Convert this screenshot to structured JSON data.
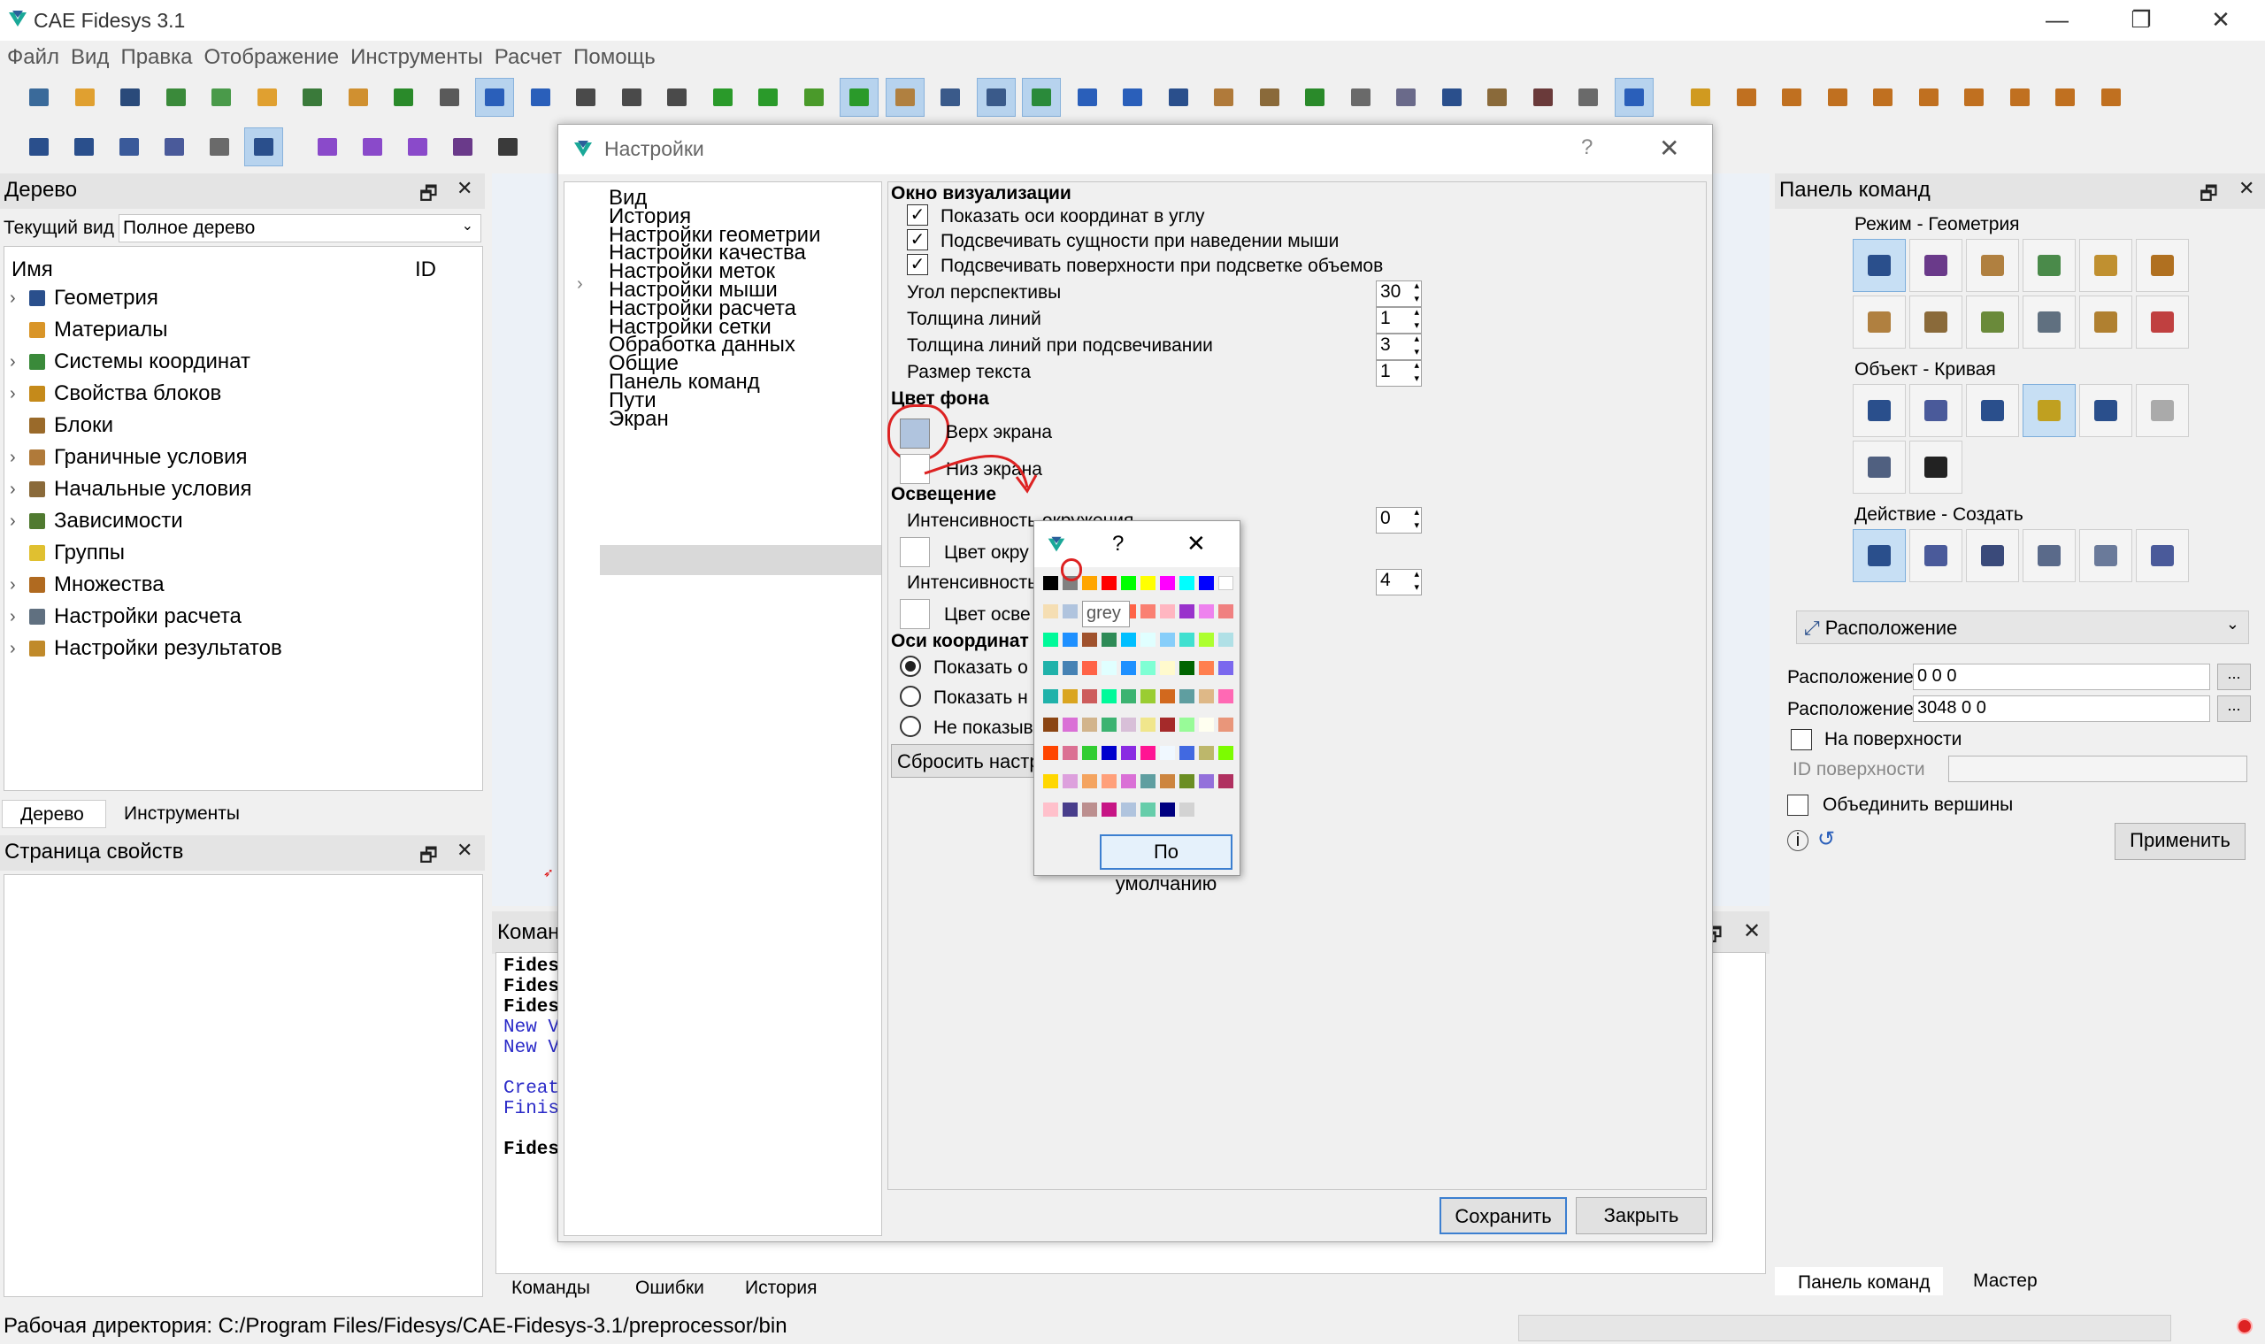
{
  "window": {
    "title": "CAE Fidesys 3.1",
    "min": "—",
    "max": "❐",
    "close": "✕"
  },
  "menu": [
    "Файл",
    "Вид",
    "Правка",
    "Отображение",
    "Инструменты",
    "Расчет",
    "Помощь"
  ],
  "tree_panel": {
    "title": "Дерево",
    "view_label": "Текущий вид",
    "view_value": "Полное дерево",
    "col_name": "Имя",
    "col_id": "ID",
    "items": [
      {
        "label": "Геометрия",
        "color": "#2a4f8c"
      },
      {
        "label": "Материалы",
        "color": "#d99528"
      },
      {
        "label": "Системы координат",
        "color": "#3a8a3a"
      },
      {
        "label": "Свойства блоков",
        "color": "#c58a1a"
      },
      {
        "label": "Блоки",
        "color": "#9a6a2a"
      },
      {
        "label": "Граничные условия",
        "color": "#b07a3a"
      },
      {
        "label": "Начальные условия",
        "color": "#8a6a3a"
      },
      {
        "label": "Зависимости",
        "color": "#507a30"
      },
      {
        "label": "Группы",
        "color": "#e0c030"
      },
      {
        "label": "Множества",
        "color": "#b06a20"
      },
      {
        "label": "Настройки расчета",
        "color": "#607080"
      },
      {
        "label": "Настройки результатов",
        "color": "#c08a2a"
      }
    ],
    "tabs": [
      "Дерево",
      "Инструменты"
    ]
  },
  "props_panel": {
    "title": "Страница свойств"
  },
  "command_panel": {
    "title_partial": "Коман",
    "lines": [
      "Fides",
      "Fides",
      "Fides",
      "New V",
      "New V",
      "",
      "Creat",
      "Finis",
      "",
      "Fides"
    ],
    "tabs": [
      "Команды",
      "Ошибки",
      "История"
    ]
  },
  "status": {
    "workdir": "Рабочая директория: C:/Program Files/Fidesys/CAE-Fidesys-3.1/preprocessor/bin"
  },
  "dialog": {
    "title": "Настройки",
    "help": "?",
    "close": "✕",
    "nav": [
      "Вид",
      "История",
      "Настройки геометрии",
      "Настройки качества",
      "Настройки меток",
      "Настройки мыши",
      "Настройки расчета",
      "Настройки сетки",
      "Обработка данных",
      "Общие",
      "Панель команд",
      "Пути",
      "Экран"
    ],
    "vis_header": "Окно визуализации",
    "checks": [
      "Показать оси координат в углу",
      "Подсвечивать сущности при наведении мыши",
      "Подсвечивать поверхности при подсветке объемов"
    ],
    "spins": [
      {
        "label": "Угол перспективы",
        "value": "30"
      },
      {
        "label": "Толщина линий",
        "value": "1"
      },
      {
        "label": "Толщина линий при подсвечивании",
        "value": "3"
      },
      {
        "label": "Размер текста",
        "value": "1"
      }
    ],
    "bg_header": "Цвет фона",
    "bg_top": "Верх экрана",
    "bg_top_color": "#b0c4de",
    "bg_bottom": "Низ экрана",
    "light_header": "Освещение",
    "ambient_label": "Интенсивность окружения",
    "ambient_value": "0",
    "ambient_color": "Цвет окру",
    "light_intensity": "Интенсивность",
    "light_value": "4",
    "light_color": "Цвет осве",
    "axes_header": "Оси координат",
    "radios": [
      "Показать о",
      "Показать н",
      "Не показыв"
    ],
    "reset": "Сбросить настр",
    "save": "Сохранить",
    "close_btn": "Закрыть"
  },
  "color_popup": {
    "help": "?",
    "close": "✕",
    "tooltip": "grey",
    "default_btn": "По умолчанию",
    "colors": [
      "#000000",
      "#808080",
      "#ffa500",
      "#ff0000",
      "#00ff00",
      "#ffff00",
      "#ff00ff",
      "#00ffff",
      "#0000ff",
      "#ffffff",
      "#f5deb3",
      "#b0c4de",
      "#00bfff",
      "#32cd32",
      "#ff6347",
      "#fa8072",
      "#ffb6c1",
      "#9932cc",
      "#ee82ee",
      "#f08080",
      "#00fa9a",
      "#1e90ff",
      "#a0522d",
      "#2e8b57",
      "#00bfff",
      "#e0ffff",
      "#87cefa",
      "#40e0d0",
      "#adff2f",
      "#b0e0e6",
      "#20b2aa",
      "#4682b4",
      "#ff6347",
      "#e0ffff",
      "#1e90ff",
      "#7fffd4",
      "#fffacd",
      "#006400",
      "#ff7f50",
      "#7b68ee",
      "#20b2aa",
      "#daa520",
      "#cd5c5c",
      "#00fa9a",
      "#3cb371",
      "#9acd32",
      "#d2691e",
      "#5f9ea0",
      "#deb887",
      "#ff69b4",
      "#8b4513",
      "#da70d6",
      "#d2b48c",
      "#3cb371",
      "#d8bfd8",
      "#f0e68c",
      "#a52a2a",
      "#98fb98",
      "#fffff0",
      "#e9967a",
      "#ff4500",
      "#db7093",
      "#32cd32",
      "#0000cd",
      "#8a2be2",
      "#ff1493",
      "#f0f8ff",
      "#4169e1",
      "#bdb76b",
      "#7cfc00",
      "#ffd700",
      "#dda0dd",
      "#f4a460",
      "#ffa07a",
      "#da70d6",
      "#5f9ea0",
      "#cd853f",
      "#6b8e23",
      "#9370db",
      "#b03060",
      "#ffc0cb",
      "#483d8b",
      "#bc8f8f",
      "#c71585",
      "#b0c4de",
      "#66cdaa",
      "#000080",
      "#d3d3d3"
    ]
  },
  "right_panel": {
    "title": "Панель команд",
    "mode_label": "Режим - Геометрия",
    "object_label": "Объект - Кривая",
    "action_label": "Действие - Создать",
    "dropdown": "Расположение",
    "pos1_label": "Расположение",
    "pos1_value": "0 0 0",
    "pos2_label": "Расположение",
    "pos2_value": "3048 0 0",
    "dots": "...",
    "on_surface": "На поверхности",
    "surface_id": "ID поверхности",
    "merge": "Объединить вершины",
    "apply": "Применить",
    "tabs": [
      "Панель команд",
      "Мастер"
    ],
    "mode_colors": [
      "#2a4f8c",
      "#6a3a8a",
      "#b08040",
      "#4a8a4a",
      "#c09030",
      "#b07020",
      "#b08040",
      "#8a6a3a",
      "#6a8a3a",
      "#607080",
      "#b08030",
      "#c04040"
    ],
    "object_colors": [
      "#2a4f8c",
      "#4a5a9a",
      "#2a4f8c",
      "#c0a020",
      "#2a4f8c",
      "#aaaaaa",
      "#506080",
      "#222222"
    ],
    "action_colors": [
      "#2a4f8c",
      "#4a5a9a",
      "#3a4a7a",
      "#5a6a8a",
      "#6a7a9a",
      "#4a5a9a"
    ]
  }
}
